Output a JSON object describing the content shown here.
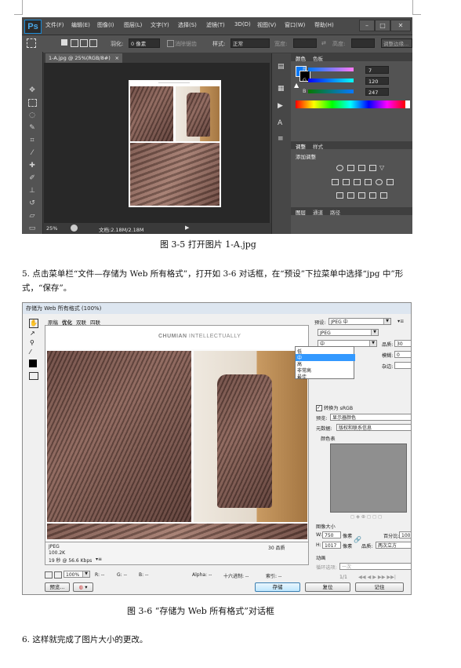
{
  "photoshop": {
    "logo": "Ps",
    "menu": [
      "文件(F)",
      "编辑(E)",
      "图像(I)",
      "图层(L)",
      "文字(Y)",
      "选择(S)",
      "滤镜(T)",
      "3D(D)",
      "视图(V)",
      "窗口(W)",
      "帮助(H)"
    ],
    "options": {
      "feather_label": "羽化:",
      "feather_value": "0 像素",
      "antialias_label": "消除锯齿",
      "style_label": "样式:",
      "style_value": "正常",
      "width_label": "宽度:",
      "height_label": "高度:",
      "refine_button": "调整边缘..."
    },
    "doc_tab": "1-A.jpg @ 25%(RGB/8#)",
    "doc_tab_close": "×",
    "status_zoom": "25%",
    "status_doc": "文档:2.18M/2.18M",
    "color_panel": {
      "tabs": [
        "颜色",
        "色板"
      ],
      "channels": [
        {
          "label": "R",
          "value": "7"
        },
        {
          "label": "G",
          "value": "120"
        },
        {
          "label": "B",
          "value": "247"
        }
      ],
      "foreground_color": "#0778f7"
    },
    "adjust_panel": {
      "tabs": [
        "调整",
        "样式"
      ],
      "title": "添加调整"
    },
    "layers_panel": {
      "tabs": [
        "图层",
        "通道",
        "路径"
      ]
    }
  },
  "caption1": "图 3-5   打开图片 1-A.jpg",
  "step5": "5. 点击菜单栏“文件—存储为 Web 所有格式”，打开如 3-6 对话框，在“预设”下拉菜单中选择“jpg 中”形式，“保存”。",
  "dialog": {
    "title": "存储为 Web 所有格式 (100%)",
    "tabs": [
      "原稿",
      "优化",
      "双联",
      "四联"
    ],
    "brand": "CHUMIAN",
    "brand_tagline": "INTELLECTUALLY",
    "preset_label": "预设:",
    "preset_value": "JPEG 中",
    "format_value": "JPEG",
    "quality_select": "中",
    "quality_options": [
      "低",
      "中",
      "高",
      "非常高",
      "最佳"
    ],
    "quality_label": "品质:",
    "quality_value": "30",
    "blur_label": "模糊:",
    "blur_value": "0",
    "matte_label": "杂边:",
    "convert_srgb": "转换为 sRGB",
    "preview_label": "预览:",
    "preview_value": "显示器颜色",
    "metadata_label": "元数据:",
    "metadata_value": "版权和联系信息",
    "color_table_label": "颜色表",
    "image_size_label": "图像大小",
    "w_label": "W:",
    "w_value": "750",
    "h_label": "H:",
    "h_value": "1017",
    "unit_px": "像素",
    "percent_label": "百分比:",
    "percent_value": "100",
    "percent_unit": "%",
    "quality2_label": "品质:",
    "quality2_value": "两次立方",
    "animation_label": "动画",
    "loop_label": "循环选项:",
    "loop_value": "一次",
    "frame_counter": "1/1",
    "info_format": "JPEG",
    "info_size": "100.2K",
    "info_time": "19 秒 @ 56.6 Kbps",
    "info_quality": "30 品质",
    "zoom_value": "100%",
    "status_r": "R: --",
    "status_g": "G: --",
    "status_b": "B: --",
    "status_alpha": "Alpha: --",
    "status_hex": "十六进制: --",
    "status_index": "索引: --",
    "preview_button": "预览...",
    "save_button": "存储",
    "reset_button": "复位",
    "remember_button": "记住"
  },
  "caption2": "图 3-6   “存储为 Web 所有格式”对话框",
  "step6": "6. 这样就完成了图片大小的更改。"
}
